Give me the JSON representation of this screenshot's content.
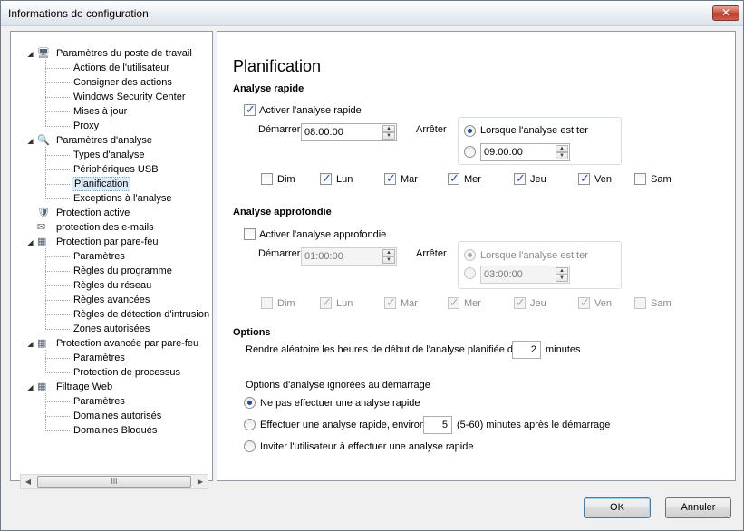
{
  "window": {
    "title": "Informations de configuration",
    "close_glyph": "✕"
  },
  "tree": {
    "items": [
      {
        "label": "Paramètres du poste de travail",
        "level": 0,
        "icon": "workstation-icon"
      },
      {
        "label": "Actions de l'utilisateur",
        "level": 1
      },
      {
        "label": "Consigner des actions",
        "level": 1
      },
      {
        "label": "Windows Security Center",
        "level": 1
      },
      {
        "label": "Mises à jour",
        "level": 1
      },
      {
        "label": "Proxy",
        "level": 1
      },
      {
        "label": "Paramètres d'analyse",
        "level": 0,
        "icon": "scan-settings-icon"
      },
      {
        "label": "Types d'analyse",
        "level": 1
      },
      {
        "label": "Périphériques USB",
        "level": 1
      },
      {
        "label": "Planification",
        "level": 1,
        "selected": true
      },
      {
        "label": "Exceptions à l'analyse",
        "level": 1
      },
      {
        "label": "Protection active",
        "level": 0,
        "icon": "active-protection-icon"
      },
      {
        "label": "protection des e-mails",
        "level": 0,
        "icon": "email-icon"
      },
      {
        "label": "Protection par pare-feu",
        "level": 0,
        "icon": "firewall-icon"
      },
      {
        "label": "Paramètres",
        "level": 1
      },
      {
        "label": "Règles du programme",
        "level": 1
      },
      {
        "label": "Règles du réseau",
        "level": 1
      },
      {
        "label": "Règles avancées",
        "level": 1
      },
      {
        "label": "Règles de détection d'intrusion",
        "level": 1
      },
      {
        "label": "Zones autorisées",
        "level": 1
      },
      {
        "label": "Protection avancée par pare-feu",
        "level": 0,
        "icon": "advanced-firewall-icon"
      },
      {
        "label": "Paramètres",
        "level": 1
      },
      {
        "label": "Protection de processus",
        "level": 1
      },
      {
        "label": "Filtrage Web",
        "level": 0,
        "icon": "web-filter-icon"
      },
      {
        "label": "Paramètres",
        "level": 1
      },
      {
        "label": "Domaines autorisés",
        "level": 1
      },
      {
        "label": "Domaines Bloqués",
        "level": 1
      }
    ],
    "scroll_grip": "III"
  },
  "page": {
    "title": "Planification"
  },
  "quick_scan": {
    "section_title": "Analyse rapide",
    "enable_label": "Activer l'analyse rapide",
    "enabled": true,
    "start_label": "Démarrer",
    "start_time": "08:00:00",
    "stop_label": "Arrêter",
    "stop_when_done_label": "Lorsque l'analyse est ter",
    "stop_when_done": true,
    "stop_time": "09:00:00",
    "days": [
      {
        "label": "Dim",
        "checked": false
      },
      {
        "label": "Lun",
        "checked": true
      },
      {
        "label": "Mar",
        "checked": true
      },
      {
        "label": "Mer",
        "checked": true
      },
      {
        "label": "Jeu",
        "checked": true
      },
      {
        "label": "Ven",
        "checked": true
      },
      {
        "label": "Sam",
        "checked": false
      }
    ]
  },
  "deep_scan": {
    "section_title": "Analyse approfondie",
    "enable_label": "Activer l'analyse approfondie",
    "enabled": false,
    "start_label": "Démarrer",
    "start_time": "01:00:00",
    "stop_label": "Arrêter",
    "stop_when_done_label": "Lorsque l'analyse est ter",
    "stop_when_done": true,
    "stop_time": "03:00:00",
    "days": [
      {
        "label": "Dim",
        "checked": false
      },
      {
        "label": "Lun",
        "checked": true
      },
      {
        "label": "Mar",
        "checked": true
      },
      {
        "label": "Mer",
        "checked": true
      },
      {
        "label": "Jeu",
        "checked": true
      },
      {
        "label": "Ven",
        "checked": true
      },
      {
        "label": "Sam",
        "checked": false
      }
    ]
  },
  "options": {
    "section_title": "Options",
    "randomize_label": "Rendre aléatoire les heures de début de l'analyse planifiée de",
    "randomize_value": "2",
    "randomize_unit": "minutes",
    "startup_title": "Options d'analyse ignorées au démarrage",
    "startup_options": {
      "no_scan": "Ne pas effectuer une analyse rapide",
      "scan_after": "Effectuer une analyse rapide, environ",
      "scan_after_value": "5",
      "scan_after_suffix": "(5-60) minutes après le démarrage",
      "ask_user": "Inviter l'utilisateur à effectuer une analyse rapide",
      "selected": "no_scan"
    }
  },
  "footer": {
    "ok_label": "OK",
    "cancel_label": "Annuler"
  }
}
